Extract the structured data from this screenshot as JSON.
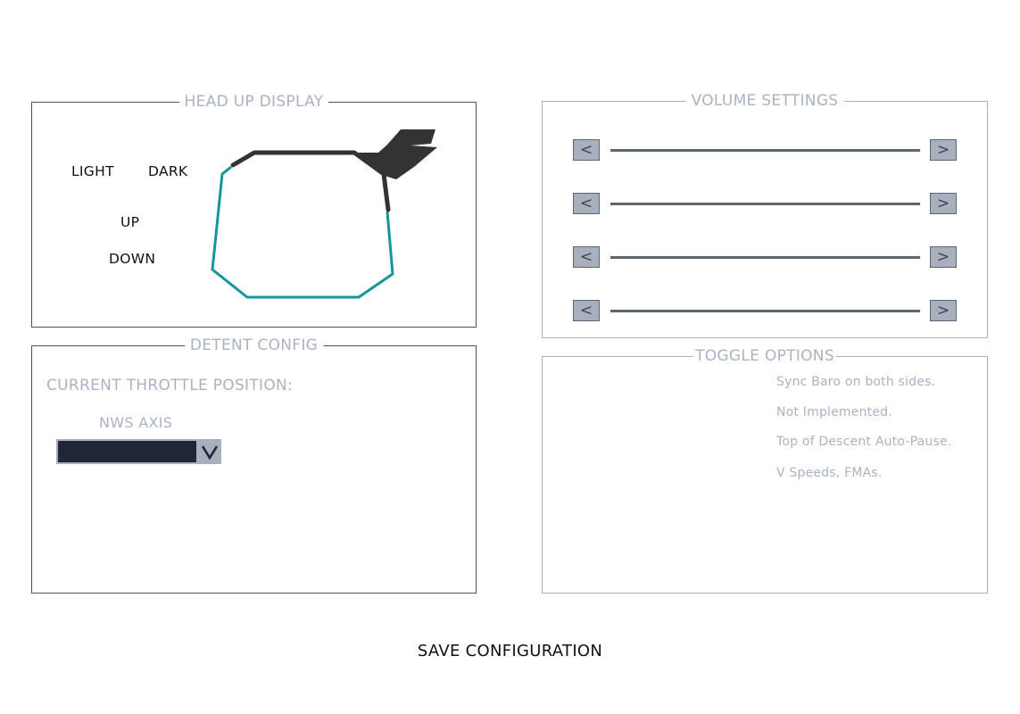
{
  "hud": {
    "title": "HEAD UP DISPLAY",
    "brightness_light": "LIGHT",
    "brightness_dark": "DARK",
    "position_up": "UP",
    "position_down": "DOWN"
  },
  "detent": {
    "title": "DETENT CONFIG",
    "throttle_position_label": "CURRENT THROTTLE POSITION:",
    "nws_axis_label": "NWS AXIS",
    "nws_axis_value": ""
  },
  "volume": {
    "title": "VOLUME SETTINGS",
    "decrease_label": "<",
    "increase_label": ">",
    "rows": 4
  },
  "toggles": {
    "title": "TOGGLE OPTIONS",
    "items": [
      "Sync Baro on both sides.",
      "Not Implemented.",
      "Top of Descent Auto-Pause.",
      "V Speeds, FMAs."
    ]
  },
  "footer": {
    "save_label": "SAVE CONFIGURATION"
  },
  "colors": {
    "panel_border_dark": "#4a5560",
    "panel_border_light": "#a9b0bd",
    "title_text": "#a9b3c2",
    "hud_outline": "#14979c",
    "hud_arm": "#333333",
    "dropdown_field": "#1e2733"
  },
  "icons": {
    "dropdown": "chevron-down-icon",
    "hud_glass": "hud-combiner-icon"
  }
}
